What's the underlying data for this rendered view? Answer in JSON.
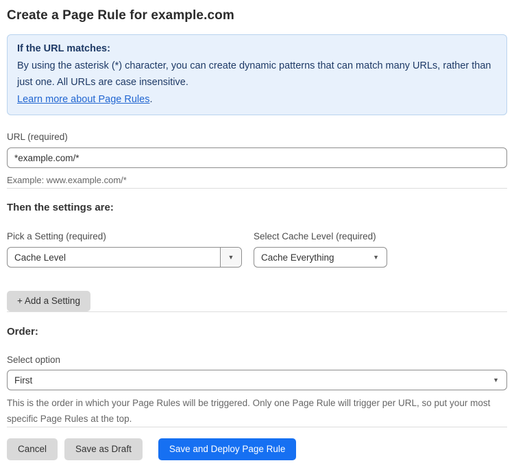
{
  "page": {
    "title": "Create a Page Rule for example.com"
  },
  "info_box": {
    "heading": "If the URL matches:",
    "body": "By using the asterisk (*) character, you can create dynamic patterns that can match many URLs, rather than just one. All URLs are case insensitive.",
    "link_label": "Learn more about Page Rules",
    "link_suffix": "."
  },
  "url_field": {
    "label": "URL (required)",
    "value": "*example.com/*",
    "helper": "Example: www.example.com/*"
  },
  "settings_section": {
    "heading": "Then the settings are:",
    "setting_picker": {
      "label": "Pick a Setting (required)",
      "value": "Cache Level"
    },
    "cache_level_picker": {
      "label": "Select Cache Level (required)",
      "value": "Cache Everything"
    },
    "add_setting_label": "+ Add a Setting"
  },
  "order_section": {
    "heading": "Order:",
    "label": "Select option",
    "value": "First",
    "helper": "This is the order in which your Page Rules will be triggered. Only one Page Rule will trigger per URL, so put your most specific Page Rules at the top."
  },
  "actions": {
    "cancel": "Cancel",
    "save_draft": "Save as Draft",
    "save_deploy": "Save and Deploy Page Rule"
  },
  "icons": {
    "dropdown_arrow": "▼"
  },
  "colors": {
    "accent_blue": "#1670f2",
    "info_bg": "#e8f1fc",
    "info_border": "#b9d3ee",
    "info_text": "#1e3a66",
    "link_blue": "#2166d1",
    "button_gray": "#d9d9d9"
  }
}
